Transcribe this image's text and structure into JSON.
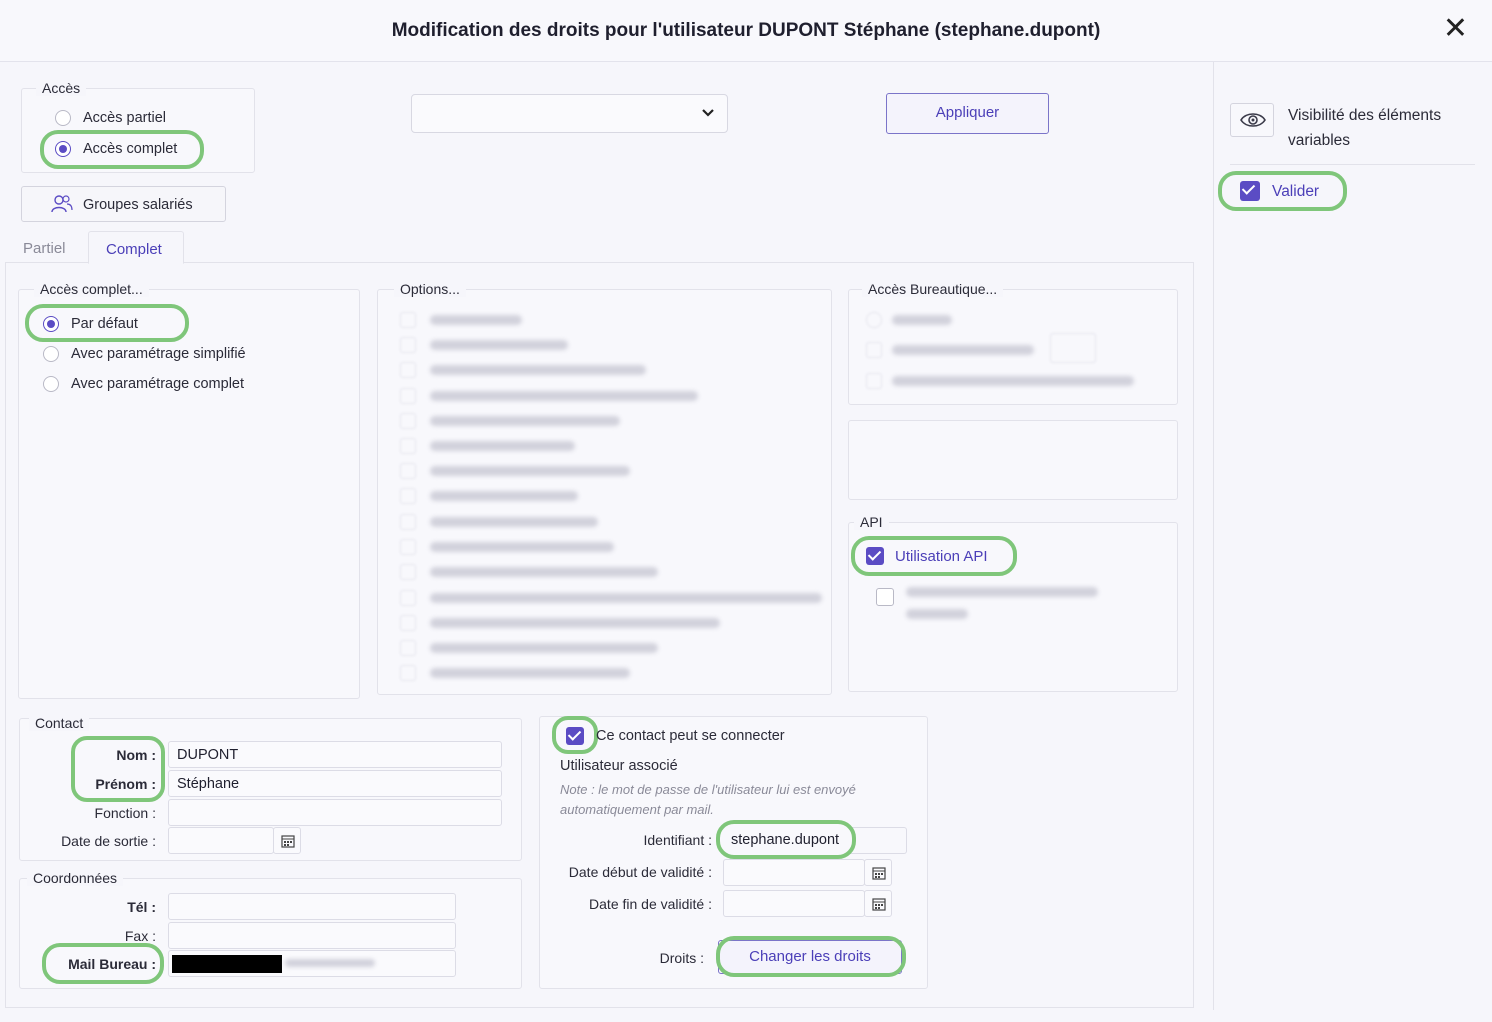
{
  "dialog": {
    "title": "Modification des droits pour l'utilisateur DUPONT Stéphane (stephane.dupont)",
    "close_icon": "close-icon"
  },
  "access": {
    "legend": "Accès",
    "options": [
      "Accès partiel",
      "Accès complet"
    ],
    "selected": "Accès complet"
  },
  "toolbar": {
    "dropdown_value": "",
    "apply_label": "Appliquer",
    "groups_label": "Groupes salariés"
  },
  "tabs": [
    "Partiel",
    "Complet"
  ],
  "active_tab": "Complet",
  "full_access": {
    "legend": "Accès complet...",
    "options": [
      "Par défaut",
      "Avec paramétrage simplifié",
      "Avec paramétrage complet"
    ],
    "selected": "Par défaut"
  },
  "options_panel": {
    "legend": "Options..."
  },
  "office_access": {
    "legend": "Accès Bureautique..."
  },
  "api": {
    "legend": "API",
    "usage_label": "Utilisation API",
    "usage_checked": true,
    "password_generation_checked": false
  },
  "contact": {
    "legend": "Contact",
    "nom_label": "Nom :",
    "nom_value": "DUPONT",
    "prenom_label": "Prénom :",
    "prenom_value": "Stéphane",
    "fonction_label": "Fonction :",
    "fonction_value": "",
    "date_sortie_label": "Date de sortie :",
    "date_sortie_value": ""
  },
  "coordonnees": {
    "legend": "Coordonnées",
    "tel_label": "Tél :",
    "fax_label": "Fax :",
    "mail_label": "Mail Bureau :"
  },
  "login": {
    "can_connect_label": "Ce contact peut se connecter",
    "can_connect_checked": true,
    "associated_user": "Utilisateur associé",
    "note_line1": "Note : le mot de passe de l'utilisateur lui est envoyé",
    "note_line2": "automatiquement par mail.",
    "identifiant_label": "Identifiant :",
    "identifiant_value": "stephane.dupont",
    "date_debut_label": "Date début de validité :",
    "date_fin_label": "Date fin de validité :",
    "droits_label": "Droits :",
    "change_rights_label": "Changer les droits"
  },
  "visibility": {
    "label_line1": "Visibilité des éléments",
    "label_line2": "variables",
    "validate_label": "Valider",
    "validate_checked": true
  },
  "colors": {
    "accent": "#5b4cc4",
    "highlight": "#7fc67a",
    "background": "#f6f6fb"
  }
}
